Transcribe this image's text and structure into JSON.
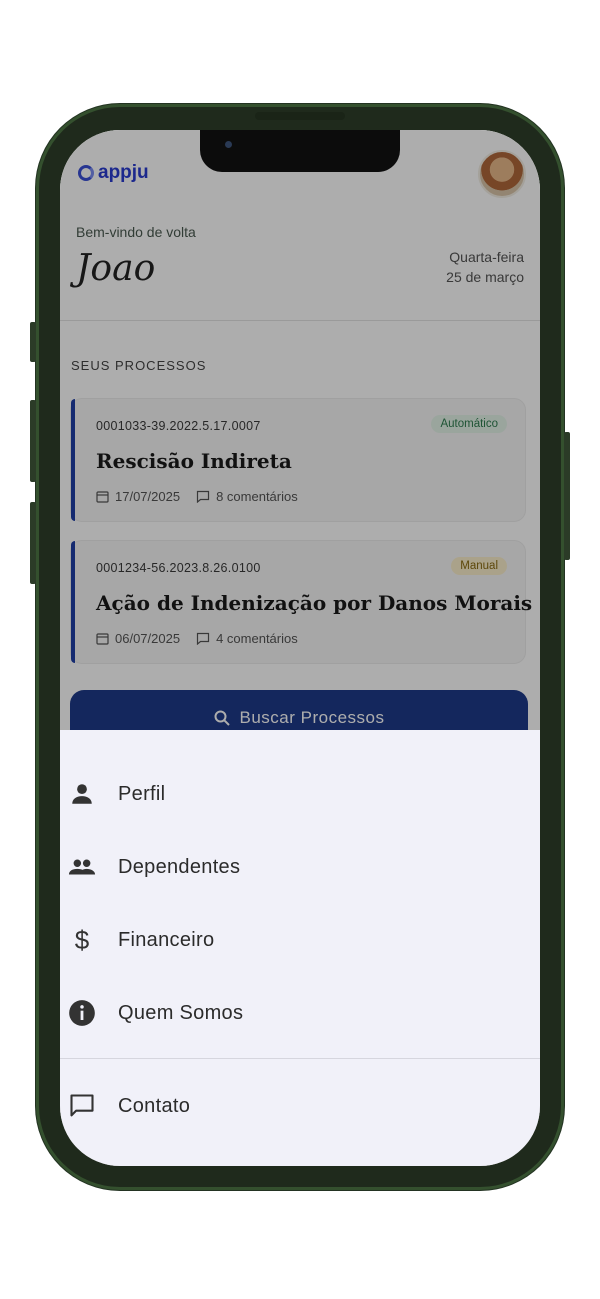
{
  "header": {
    "logo_text": "appju",
    "welcome": "Bem-vindo de volta",
    "user_name": "Joao",
    "weekday": "Quarta-feira",
    "date": "25 de março"
  },
  "section_title": "SEUS PROCESSOS",
  "processes": [
    {
      "number": "0001033-39.2022.5.17.0007",
      "badge": "Automático",
      "badge_color": "#2e7d4f",
      "badge_bg": "#e3f3e8",
      "title": "Rescisão Indireta",
      "date": "17/07/2025",
      "comments": "8 comentários"
    },
    {
      "number": "0001234-56.2023.8.26.0100",
      "badge": "Manual",
      "badge_color": "#8a6a10",
      "badge_bg": "#fbefcc",
      "title": "Ação de Indenização por Danos Morais",
      "date": "06/07/2025",
      "comments": "4 comentários"
    }
  ],
  "search_button": "Buscar Processos",
  "menu": [
    {
      "label": "Perfil",
      "icon": "person-icon"
    },
    {
      "label": "Dependentes",
      "icon": "people-icon"
    },
    {
      "label": "Financeiro",
      "icon": "dollar-icon"
    },
    {
      "label": "Quem Somos",
      "icon": "info-icon"
    },
    {
      "label": "Contato",
      "icon": "chat-icon"
    }
  ],
  "colors": {
    "primary": "#1e3a8a",
    "accent": "#2a3bd0",
    "sheet_bg": "#f1f1f9"
  }
}
